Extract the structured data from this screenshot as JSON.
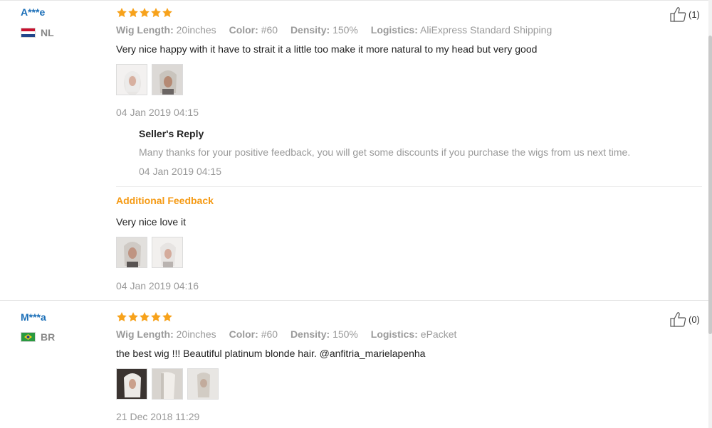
{
  "reviews": [
    {
      "user": "A***e",
      "country": "NL",
      "flag_icon": "netherlands-flag-icon",
      "rating": 5,
      "attributes": [
        {
          "label": "Wig Length:",
          "value": "20inches"
        },
        {
          "label": "Color:",
          "value": "#60"
        },
        {
          "label": "Density:",
          "value": "150%"
        },
        {
          "label": "Logistics:",
          "value": "AliExpress Standard Shipping"
        }
      ],
      "text": "Very nice happy with it have to strait it a little too make it more natural to my head but very good",
      "photo_count": 2,
      "date": "04 Jan 2019 04:15",
      "helpful_count": "(1)",
      "seller_reply": {
        "heading": "Seller's Reply",
        "text": "Many thanks for your positive feedback, you will get some discounts if you purchase the wigs from us next time.",
        "date": "04 Jan 2019 04:15"
      },
      "additional_feedback": {
        "heading": "Additional Feedback",
        "text": "Very nice love it",
        "photo_count": 2,
        "date": "04 Jan 2019 04:16"
      }
    },
    {
      "user": "M***a",
      "country": "BR",
      "flag_icon": "brazil-flag-icon",
      "rating": 5,
      "attributes": [
        {
          "label": "Wig Length:",
          "value": "20inches"
        },
        {
          "label": "Color:",
          "value": "#60"
        },
        {
          "label": "Density:",
          "value": "150%"
        },
        {
          "label": "Logistics:",
          "value": "ePacket"
        }
      ],
      "text": "the best wig !!! Beautiful platinum blonde hair. @anfitria_marielapenha",
      "photo_count": 3,
      "date": "21 Dec 2018 11:29",
      "helpful_count": "(0)"
    }
  ],
  "colors": {
    "username": "#1b6fb8",
    "star": "#f7a21b",
    "additional_heading": "#f59a14",
    "muted_text": "#999999"
  }
}
